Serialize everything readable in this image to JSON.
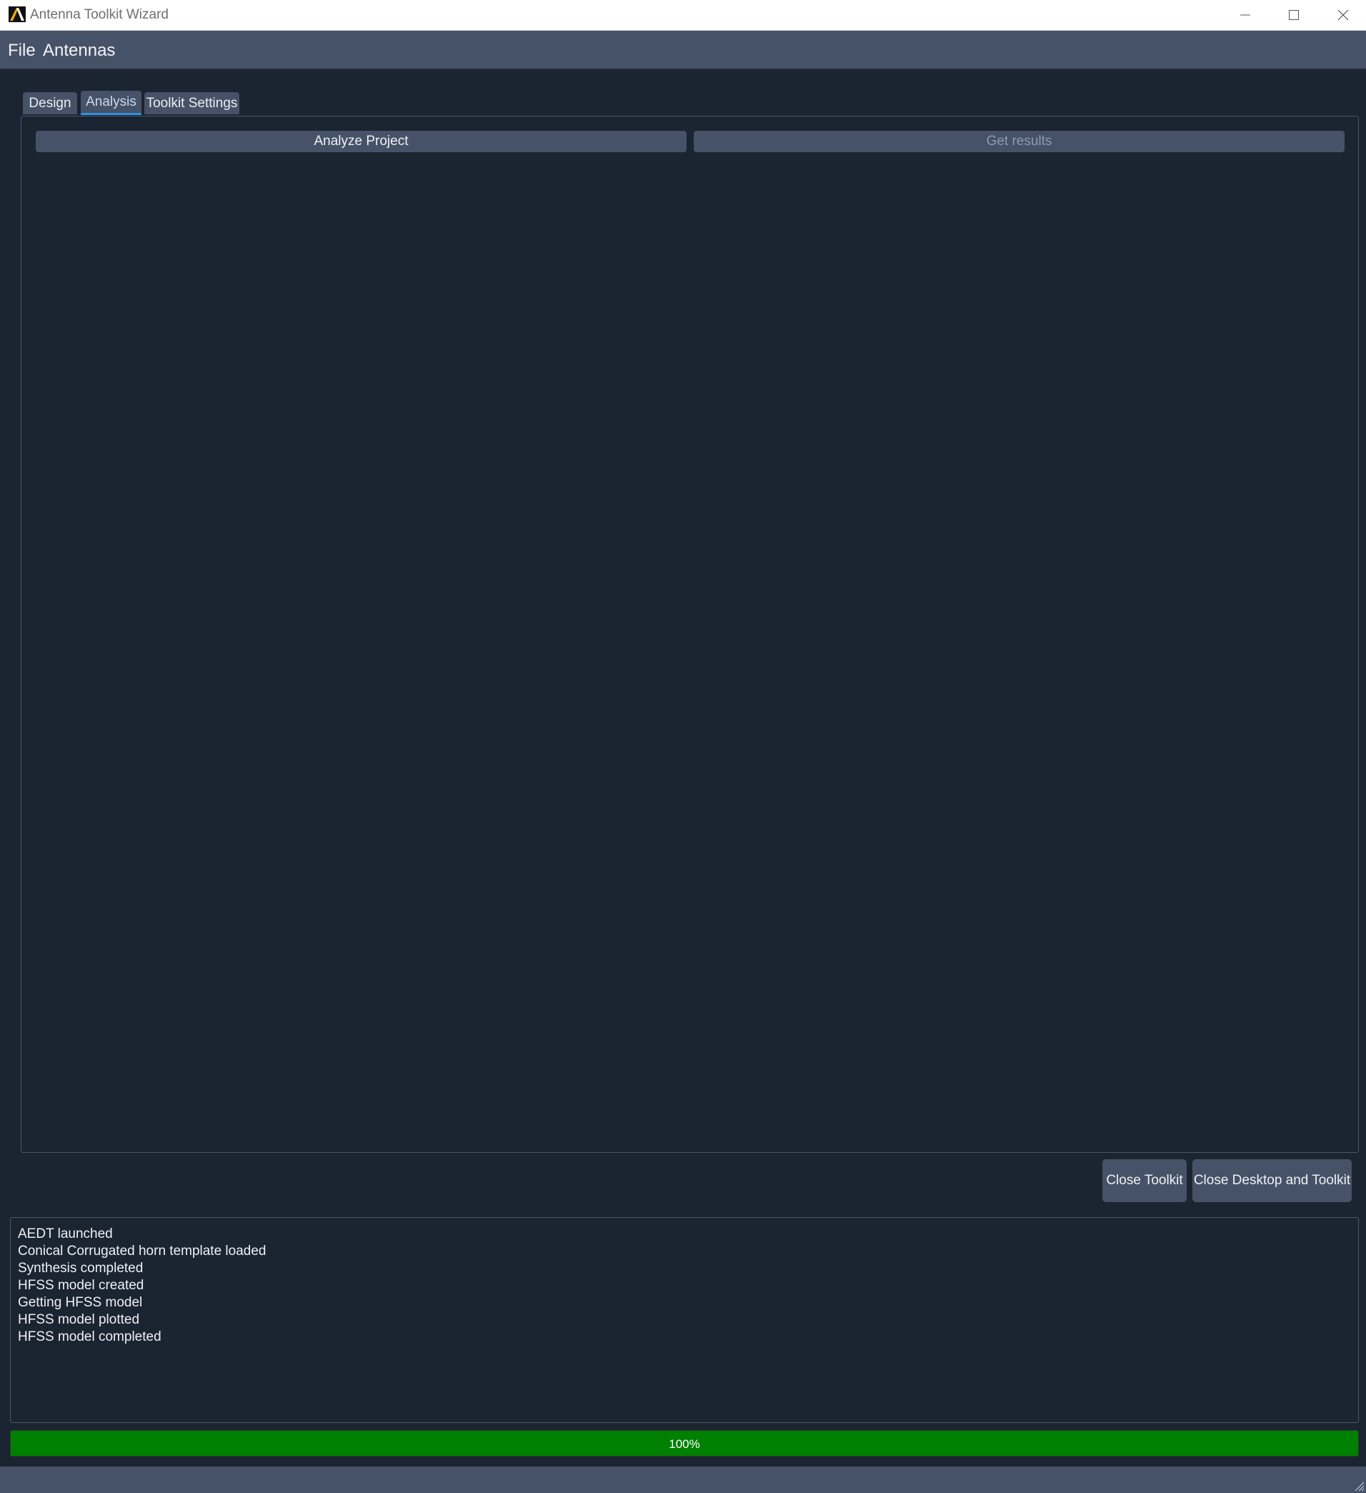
{
  "window": {
    "title": "Antenna Toolkit Wizard",
    "logo_icon": "ansys-logo-icon",
    "controls": [
      "minimize-icon",
      "maximize-icon",
      "close-icon"
    ]
  },
  "menu": {
    "file": "File",
    "antennas": "Antennas"
  },
  "tabs": [
    {
      "label": "Design",
      "active": false
    },
    {
      "label": "Analysis",
      "active": true
    },
    {
      "label": "Toolkit Settings",
      "active": false
    }
  ],
  "analysis": {
    "analyze_label": "Analyze Project",
    "get_results_label": "Get results",
    "get_results_enabled": false
  },
  "actions": {
    "close_toolkit": "Close Toolkit",
    "close_desktop_and_toolkit": "Close Desktop and Toolkit"
  },
  "log": [
    "AEDT launched",
    "Conical Corrugated horn template loaded",
    "Synthesis completed",
    "HFSS model created",
    "Getting HFSS model",
    "HFSS model plotted",
    "HFSS model completed"
  ],
  "progress": {
    "value": 100,
    "label": "100%"
  },
  "colors": {
    "background": "#1b2431",
    "panel": "#465267",
    "accent": "#2f8fe0",
    "progress": "#008000"
  }
}
